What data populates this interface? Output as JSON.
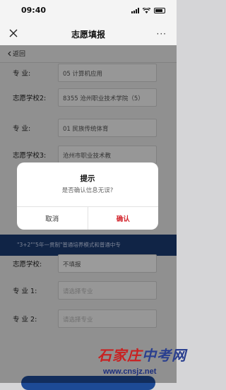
{
  "status_bar": {
    "time": "09:40"
  },
  "nav": {
    "title": "志愿填报",
    "more": "···"
  },
  "back": {
    "label": "返回"
  },
  "form": {
    "rows": [
      {
        "label": "专    业:",
        "value": "05 计算机应用"
      },
      {
        "label": "志愿学校2:",
        "value": "8355 沧州职业技术学院（5）"
      },
      {
        "label": "专    业:",
        "value": "01 民族传统体育"
      },
      {
        "label": "志愿学校3:",
        "value": "沧州市职业技术教"
      },
      {
        "label": "志愿学校:",
        "value": "不填报"
      },
      {
        "label": "专 业 1:",
        "value": "请选择专业"
      },
      {
        "label": "专 业 2:",
        "value": "请选择专业"
      }
    ],
    "banner_text": "\"3+2\"\"5年一贯制\"普通培养模式和普通中专"
  },
  "dialog": {
    "title": "提示",
    "message": "是否确认信息无误?",
    "cancel_label": "取消",
    "confirm_label": "确认"
  },
  "watermark": {
    "text_red": "石家庄",
    "text_blue": "中考网",
    "url": "www.cnsjz.net"
  },
  "colors": {
    "confirm": "#d3232b",
    "banner": "#1b3a72",
    "submit": "#1d4a95"
  }
}
